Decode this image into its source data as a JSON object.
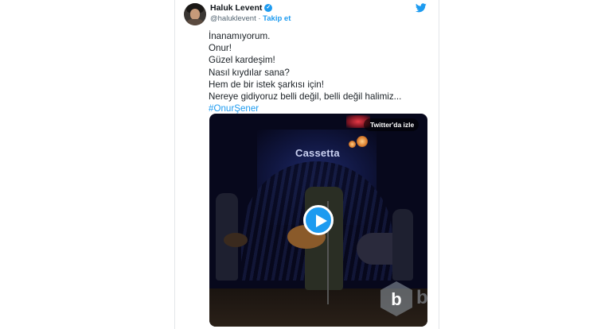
{
  "tweet": {
    "author_name": "Haluk Levent",
    "author_handle": "@haluklevent",
    "separator": "·",
    "follow_label": "Takip et",
    "text_lines": [
      "İnanamıyorum.",
      "Onur!",
      "Güzel kardeşim!",
      "Nasıl kıydılar sana?",
      "Hem de bir istek şarkısı için!",
      "Nereye gidiyoruz belli değil, belli değil halimiz..."
    ],
    "hashtag": "#OnurŞener"
  },
  "video": {
    "watch_on_twitter_label": "Twitter'da izle",
    "stage_sign": "Cassetta"
  },
  "watermark": {
    "letter": "b"
  },
  "icons": {
    "verified": "verified-badge-icon",
    "twitter": "twitter-bird-icon",
    "play": "play-icon",
    "watermark": "watermark-logo-icon"
  },
  "colors": {
    "accent": "#1d9bf0",
    "text": "#1b2126",
    "muted": "#536471"
  }
}
